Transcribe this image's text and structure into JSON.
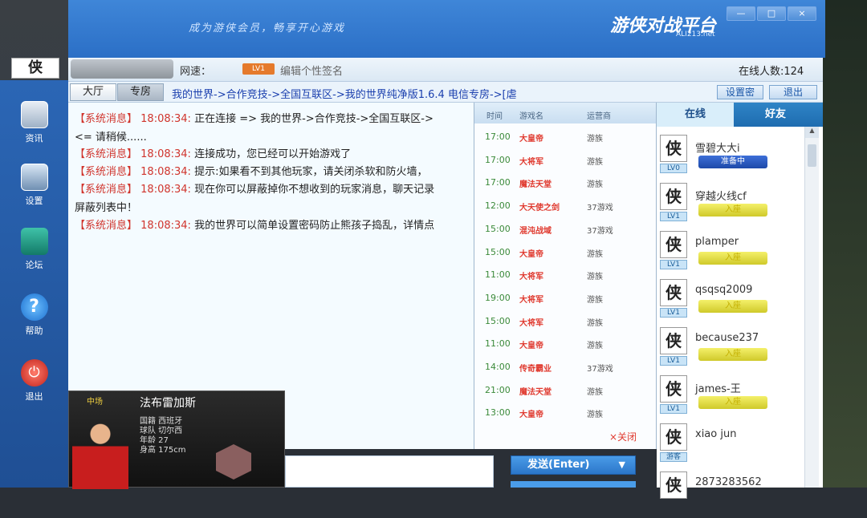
{
  "window": {
    "slogan": "成为游侠会员，畅享开心游戏",
    "brand": "游侠对战平台",
    "brand_sub": "ALI213.net",
    "buttons": [
      "—",
      "□",
      "×"
    ]
  },
  "sidebar": {
    "items": [
      {
        "label": "资讯",
        "icon": "news-icon"
      },
      {
        "label": "设置",
        "icon": "settings-icon"
      },
      {
        "label": "论坛",
        "icon": "forum-icon"
      },
      {
        "label": "帮助",
        "icon": "help-icon"
      },
      {
        "label": "退出",
        "icon": "power-icon"
      }
    ]
  },
  "infobar": {
    "speed_label": "网速：",
    "level": "LV1",
    "signature": "编辑个性签名",
    "online_count": "在线人数:124"
  },
  "nav": {
    "tabs": [
      "大厅",
      "专房"
    ],
    "breadcrumb": "我的世界->合作竞技->全国互联区->我的世界纯净版1.6.4 电信专房->[虐",
    "set_password": "设置密",
    "exit": "退出"
  },
  "chat": {
    "messages": [
      {
        "tag": "【系统消息】",
        "time": "18:08:34:",
        "text": "正在连接 => 我的世界->合作竞技->全国互联区->"
      },
      {
        "tag": "",
        "time": "",
        "text": "<= 请稍候......"
      },
      {
        "tag": "【系统消息】",
        "time": "18:08:34:",
        "text": "连接成功，您已经可以开始游戏了"
      },
      {
        "tag": "【系统消息】",
        "time": "18:08:34:",
        "text": "提示:如果看不到其他玩家，请关闭杀软和防火墙，"
      },
      {
        "tag": "【系统消息】",
        "time": "18:08:34:",
        "text": "现在你可以屏蔽掉你不想收到的玩家消息，聊天记录"
      },
      {
        "tag": "",
        "time": "",
        "text": "屏蔽列表中！"
      },
      {
        "tag": "【系统消息】",
        "time": "18:08:34:",
        "text": "我的世界可以简单设置密码防止熊孩子捣乱，详情点"
      }
    ],
    "send_label": "发送(Enter)",
    "send_arrow": "▼"
  },
  "rooms": {
    "headers": [
      "时间",
      "游戏名",
      "运营商"
    ],
    "rows": [
      {
        "time": "17:00",
        "name": "大皇帝",
        "op": "游族"
      },
      {
        "time": "17:00",
        "name": "大将军",
        "op": "游族"
      },
      {
        "time": "17:00",
        "name": "魔法天堂",
        "op": "游族"
      },
      {
        "time": "12:00",
        "name": "大天使之剑",
        "op": "37游戏"
      },
      {
        "time": "15:00",
        "name": "混沌战域",
        "op": "37游戏"
      },
      {
        "time": "15:00",
        "name": "大皇帝",
        "op": "游族"
      },
      {
        "time": "11:00",
        "name": "大将军",
        "op": "游族"
      },
      {
        "time": "19:00",
        "name": "大将军",
        "op": "游族"
      },
      {
        "time": "15:00",
        "name": "大将军",
        "op": "游族"
      },
      {
        "time": "11:00",
        "name": "大皇帝",
        "op": "游族"
      },
      {
        "time": "14:00",
        "name": "传奇霸业",
        "op": "37游戏"
      },
      {
        "time": "21:00",
        "name": "魔法天堂",
        "op": "游族"
      },
      {
        "time": "13:00",
        "name": "大皇帝",
        "op": "游族"
      }
    ],
    "close_label": "×关闭"
  },
  "users": {
    "tabs": [
      "在线",
      "好友"
    ],
    "list": [
      {
        "name": "雪碧大大i",
        "level": "LV0",
        "status": "准备中",
        "kind": "ready"
      },
      {
        "name": "穿越火线cf",
        "level": "LV1",
        "status": "入座",
        "kind": "seat"
      },
      {
        "name": "plamper",
        "level": "LV1",
        "status": "入座",
        "kind": "seat"
      },
      {
        "name": "qsqsq2009",
        "level": "LV1",
        "status": "入座",
        "kind": "seat"
      },
      {
        "name": "because237",
        "level": "LV1",
        "status": "入座",
        "kind": "seat"
      },
      {
        "name": "james-王",
        "level": "LV1",
        "status": "入座",
        "kind": "seat"
      },
      {
        "name": "xiao jun",
        "level": "游客",
        "status": "",
        "kind": "none"
      },
      {
        "name": "2873283562",
        "level": "",
        "status": "",
        "kind": "none"
      }
    ]
  },
  "ad": {
    "position": "中场",
    "player_name": "法布雷加斯",
    "stats": [
      "国籍 西班牙",
      "球队 切尔西",
      "年龄 27",
      "身高 175cm"
    ]
  },
  "colors": {
    "accent": "#2b6fc6",
    "system_red": "#d0342c",
    "time_green": "#3b8a3a"
  }
}
